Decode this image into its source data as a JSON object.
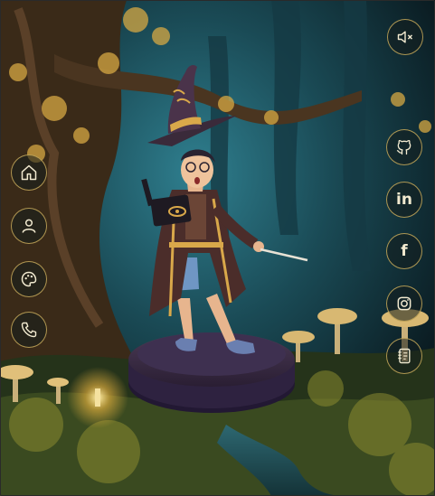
{
  "nav": {
    "items": [
      {
        "icon": "home-icon"
      },
      {
        "icon": "user-icon"
      },
      {
        "icon": "palette-icon"
      },
      {
        "icon": "phone-icon"
      }
    ]
  },
  "sound": {
    "icon": "mute-speaker-icon"
  },
  "social": {
    "items": [
      {
        "icon": "github-icon"
      },
      {
        "icon": "linkedin-icon",
        "glyph": "in"
      },
      {
        "icon": "facebook-icon",
        "glyph": "f"
      },
      {
        "icon": "instagram-icon"
      },
      {
        "icon": "resume-notebook-icon"
      }
    ]
  },
  "colors": {
    "button_border": "#c8aa5a",
    "icon": "#f2ead0"
  }
}
